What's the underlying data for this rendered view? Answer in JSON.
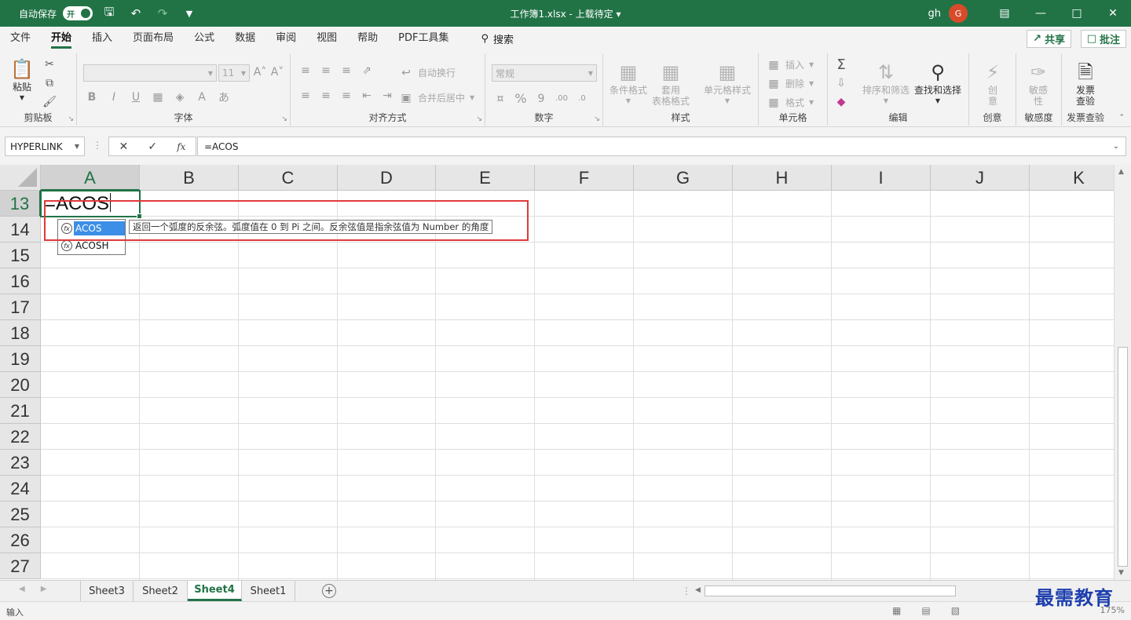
{
  "titlebar": {
    "autosave_label": "自动保存",
    "toggle_label": "开",
    "doc_title": "工作簿1.xlsx  -  上载待定",
    "user_name": "gh",
    "avatar_initial": "G"
  },
  "menu": {
    "tabs": [
      "文件",
      "开始",
      "插入",
      "页面布局",
      "公式",
      "数据",
      "审阅",
      "视图",
      "帮助",
      "PDF工具集"
    ],
    "active_tab": "开始",
    "search_label": "搜索",
    "share_label": "共享",
    "comment_label": "批注"
  },
  "ribbon": {
    "clipboard": {
      "label": "剪贴板",
      "paste": "粘贴"
    },
    "font": {
      "label": "字体",
      "font_size": "11"
    },
    "alignment": {
      "label": "对齐方式",
      "wrap_text": "自动换行",
      "merge_center": "合并后居中"
    },
    "number": {
      "label": "数字",
      "format": "常规"
    },
    "styles": {
      "label": "样式",
      "conditional": "条件格式",
      "table_format_1": "套用",
      "table_format_2": "表格格式",
      "cell_styles": "单元格样式"
    },
    "cells": {
      "label": "单元格",
      "insert": "插入",
      "delete": "删除",
      "format": "格式"
    },
    "editing": {
      "label": "编辑",
      "sort_filter": "排序和筛选",
      "find_select": "查找和选择"
    },
    "ideas": {
      "label": "创意",
      "btn_1": "创",
      "btn_2": "意"
    },
    "sensitivity": {
      "label": "敏感度",
      "btn_1": "敏感",
      "btn_2": "性"
    },
    "invoice": {
      "label": "发票查验",
      "btn_1": "发票",
      "btn_2": "查验"
    }
  },
  "formula_bar": {
    "name_box": "HYPERLINK",
    "formula": "=ACOS"
  },
  "grid": {
    "columns": [
      "A",
      "B",
      "C",
      "D",
      "E",
      "F",
      "G",
      "H",
      "I",
      "J",
      "K"
    ],
    "rows": [
      "13",
      "14",
      "15",
      "16",
      "17",
      "18",
      "19",
      "20",
      "21",
      "22",
      "23",
      "24",
      "25",
      "26",
      "27"
    ],
    "active_cell_text": "=ACOS"
  },
  "autocomplete": {
    "items": [
      "ACOS",
      "ACOSH"
    ],
    "selected": "ACOS",
    "tooltip": "返回一个弧度的反余弦。弧度值在 0 到 Pi 之间。反余弦值是指余弦值为 Number 的角度"
  },
  "sheets": {
    "tabs": [
      "Sheet3",
      "Sheet2",
      "Sheet4",
      "Sheet1"
    ],
    "active": "Sheet4"
  },
  "status": {
    "mode": "输入",
    "zoom": "175%"
  },
  "watermark": "最需教育",
  "colors": {
    "accent": "#217346",
    "highlight_box": "#e03a3a",
    "selection": "#3c8ee6"
  }
}
